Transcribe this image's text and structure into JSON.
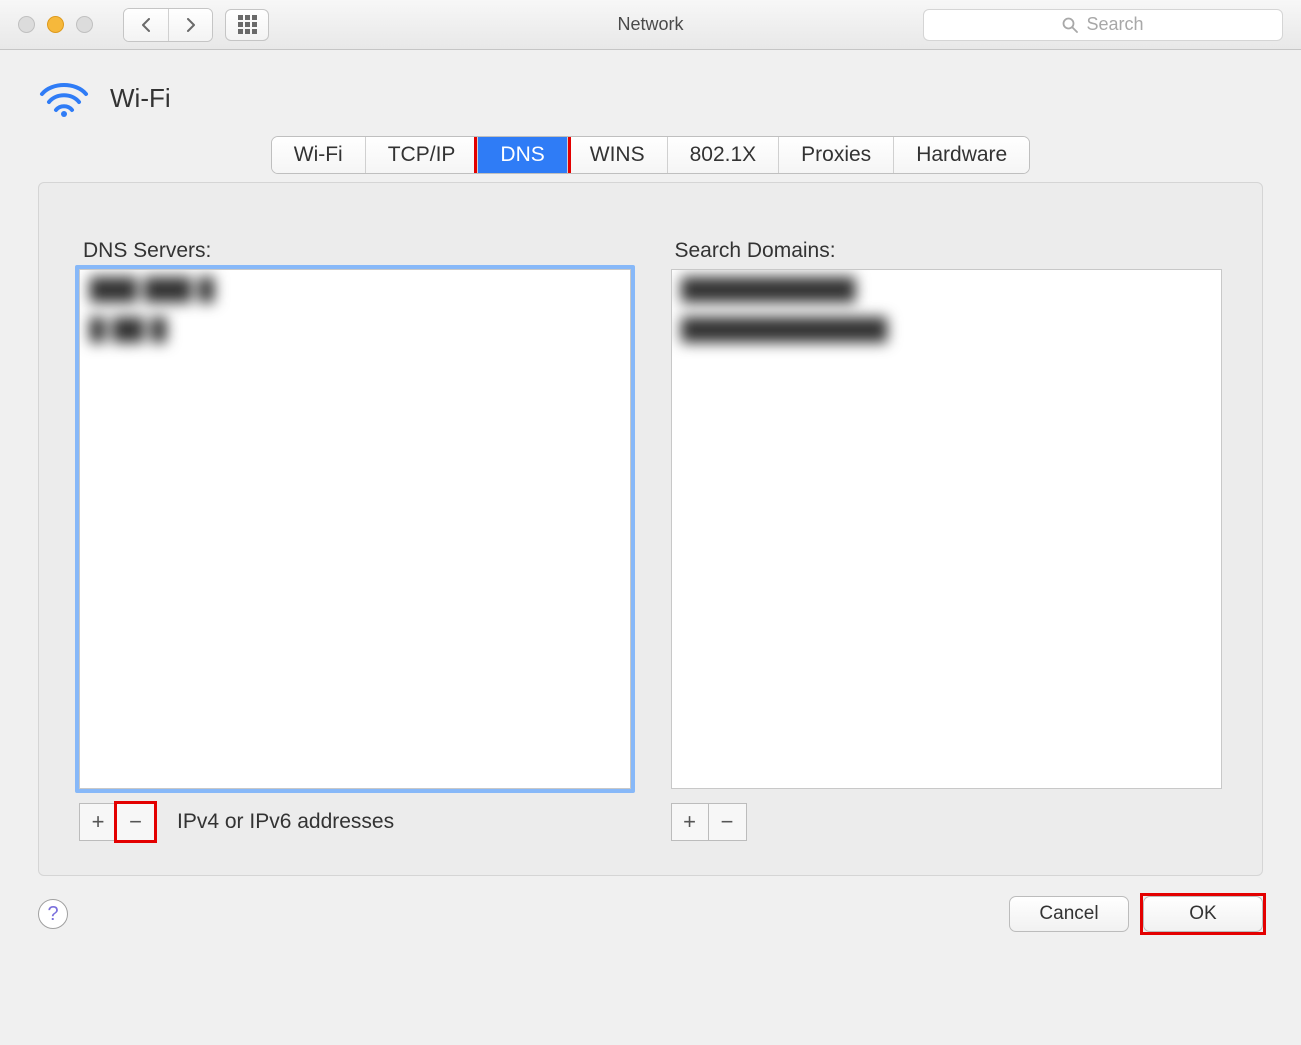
{
  "window": {
    "title": "Network"
  },
  "search": {
    "placeholder": "Search"
  },
  "header": {
    "interface_label": "Wi-Fi"
  },
  "tabs": [
    {
      "label": "Wi-Fi",
      "active": false
    },
    {
      "label": "TCP/IP",
      "active": false
    },
    {
      "label": "DNS",
      "active": true
    },
    {
      "label": "WINS",
      "active": false
    },
    {
      "label": "802.1X",
      "active": false
    },
    {
      "label": "Proxies",
      "active": false
    },
    {
      "label": "Hardware",
      "active": false
    }
  ],
  "dns": {
    "label": "DNS Servers:",
    "servers": [
      "███ ███ █",
      "█ ██ █"
    ],
    "footer_label": "IPv4 or IPv6 addresses"
  },
  "search_domains": {
    "label": "Search Domains:",
    "domains": [
      "███████████",
      "█████████████"
    ]
  },
  "buttons": {
    "plus": "+",
    "minus": "−",
    "cancel": "Cancel",
    "ok": "OK",
    "help": "?"
  }
}
